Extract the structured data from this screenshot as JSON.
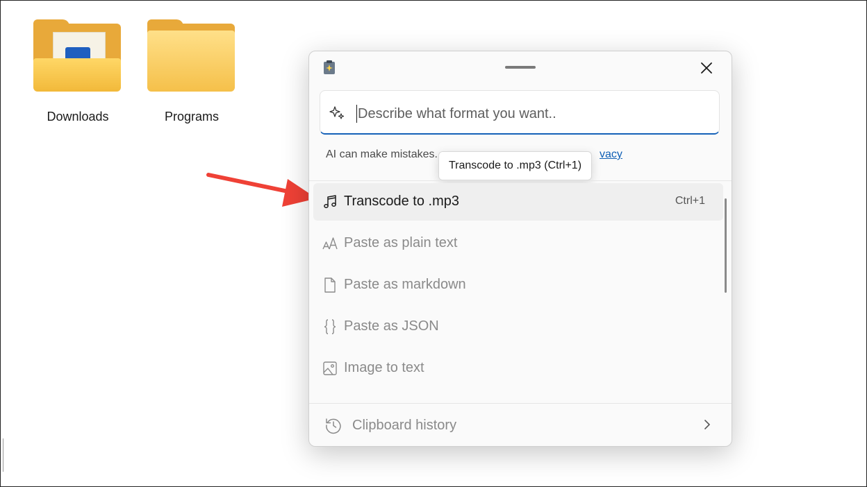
{
  "desktop": {
    "icons": [
      {
        "label": "Downloads"
      },
      {
        "label": "Programs"
      }
    ]
  },
  "panel": {
    "search": {
      "placeholder": "Describe what format you want.."
    },
    "disclaimer": "AI can make mistakes.",
    "privacy_link": "vacy",
    "tooltip": "Transcode to .mp3 (Ctrl+1)",
    "items": [
      {
        "label": "Transcode to .mp3",
        "shortcut": "Ctrl+1",
        "icon": "music-note-icon"
      },
      {
        "label": "Paste as plain text",
        "shortcut": "",
        "icon": "font-size-icon"
      },
      {
        "label": "Paste as markdown",
        "shortcut": "",
        "icon": "document-icon"
      },
      {
        "label": "Paste as JSON",
        "shortcut": "",
        "icon": "braces-icon"
      },
      {
        "label": "Image to text",
        "shortcut": "",
        "icon": "image-icon"
      }
    ],
    "footer": {
      "label": "Clipboard history"
    }
  },
  "colors": {
    "accent": "#1561b8",
    "annotation_arrow": "#ef4136"
  }
}
